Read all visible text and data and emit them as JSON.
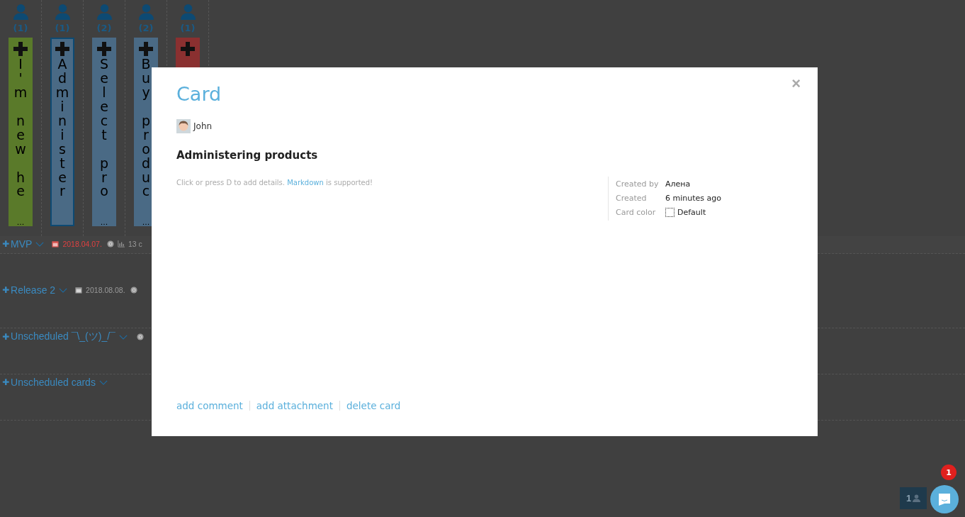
{
  "personas": [
    {
      "count": "(1)"
    },
    {
      "count": "(1)"
    },
    {
      "count": "(2)"
    },
    {
      "count": "(2)"
    },
    {
      "count": "(1)"
    }
  ],
  "cards": [
    {
      "text": "I'm new he",
      "overflow_mark": "...",
      "color": "#5a7a2a",
      "selected": false
    },
    {
      "text": "Administer",
      "color": "#4a6a85",
      "selected": true
    },
    {
      "text": "Select pro",
      "overflow_mark": "...",
      "color": "#4a6a85",
      "selected": false
    },
    {
      "text": "Buy produc",
      "overflow_mark": "...",
      "color": "#4a6a85",
      "selected": false
    },
    {
      "color": "#8a3030",
      "selected": false
    }
  ],
  "add_mark": "✚",
  "releases": [
    {
      "name": "MVP",
      "date": "2018.04.07.",
      "overdue": true,
      "target_icon": true,
      "stats": "13 c"
    },
    {
      "name": "Release 2",
      "date": "2018.08.08.",
      "overdue": false,
      "target_icon": true
    },
    {
      "name": "Unscheduled ¯\\_(ツ)_/¯",
      "target_icon": true
    },
    {
      "name": "Unscheduled cards",
      "target_icon": false
    }
  ],
  "modal": {
    "title": "Card",
    "close": "×",
    "assignee": "John",
    "heading": "Administering products",
    "hint_before": "Click or press D to add details.",
    "hint_link": "Markdown",
    "hint_after": "is supported!",
    "meta": [
      {
        "label": "Created by",
        "value": "Алена"
      },
      {
        "label": "Created",
        "value": "6 minutes ago"
      },
      {
        "label": "Card color",
        "value": "Default",
        "kind": "color"
      }
    ],
    "actions": [
      "add comment",
      "add attachment",
      "delete card"
    ]
  },
  "users_button": "1",
  "chat": {
    "badge": "1"
  }
}
